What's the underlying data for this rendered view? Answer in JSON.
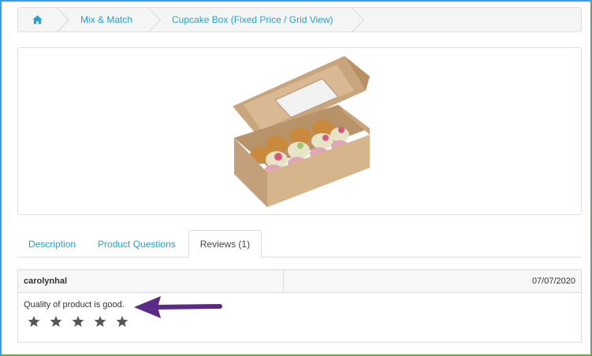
{
  "breadcrumb": {
    "home_icon": "home-icon",
    "items": [
      "Mix & Match",
      "Cupcake Box (Fixed Price / Grid View)"
    ]
  },
  "product": {
    "image_icon": "cupcake-box-image"
  },
  "tabs": [
    {
      "label": "Description",
      "active": false
    },
    {
      "label": "Product Questions",
      "active": false
    },
    {
      "label": "Reviews (1)",
      "active": true
    }
  ],
  "review": {
    "author": "carolynhal",
    "date": "07/07/2020",
    "text": "Quality of product is good.",
    "rating": 5,
    "max_rating": 5
  },
  "colors": {
    "link": "#23a1d1",
    "star": "#555555",
    "annotation_arrow": "#5b2a86",
    "frame_left": "#3aa0e0",
    "frame_bottom": "#6aaa3a"
  }
}
